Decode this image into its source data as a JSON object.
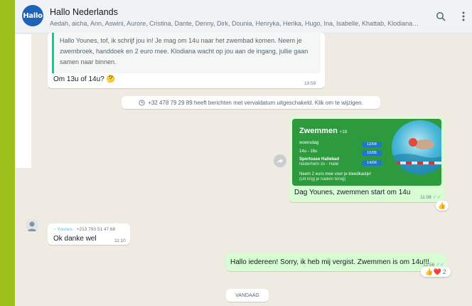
{
  "header": {
    "avatar_text": "Hallo",
    "group_name": "Hallo Nederlands",
    "members": "Aedah, aicha, Ann, Aswini, Aurore, Cristina, Dante, Denny, Dirk, Dounia, Henryka, Herika, Hugo, Ina, Isabelle, Khattab, Klodiana, 🌸L...",
    "search_icon": "search-icon",
    "menu_icon": "more-vertical-icon"
  },
  "messages": {
    "quoted_text": "Hallo Younes, tof, ik schrijf jou in! Je mag om 14u naar het zwembad komen. Neem je zwembroek, handdoek en 2 euro mee. Klodiana wacht op jou aan de ingang, jullie gaan samen naar binnen.",
    "reply_text": "Om 13u of  14u? 🤔",
    "reply_time": "10:59",
    "system_notice": "+32 478 79 29 89 heeft berichten met vervaldatum uitgeschakeld. Klik om te wijzigen.",
    "poster": {
      "title": "Zwemmen",
      "age": "+18",
      "day": "woensdag",
      "time": "14u - 16u",
      "place": "Sportoase Hallebad",
      "address": "Nederhem 35 - Halle",
      "dates": [
        "12/04",
        "10/05",
        "14/06"
      ],
      "note1": "Neem 2 euro mee voor je kleedkastje!",
      "note2": "(Dit krijg je nadien terug)"
    },
    "image_caption": "Dag Younes, zwemmen start om 14u",
    "image_time": "11:08",
    "image_reaction": "👍",
    "sender_name": "~ Younes",
    "sender_phone": "+213 793 51 47 68",
    "younes_text": "Ok danke wel",
    "younes_time": "11:10",
    "out_text": "Hallo iedereen! Sorry, ik heb mij vergist. Zwemmen is om 14u!!!",
    "out_time": "12:56",
    "out_reactions": "👍❤️",
    "out_reaction_count": "2",
    "day_divider": "VANDAAG"
  },
  "colors": {
    "outer_frame": "#9bc11a",
    "chat_bg": "#efeae2",
    "outgoing_bubble": "#d9fdd3",
    "poster_green": "#2e9a3e",
    "read_ticks": "#53bdeb"
  }
}
